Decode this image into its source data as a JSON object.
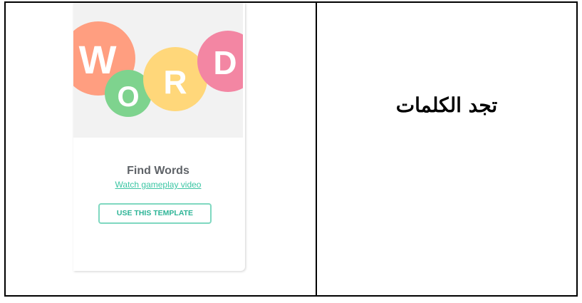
{
  "card": {
    "image_letters": [
      "W",
      "O",
      "R",
      "D"
    ],
    "colors": {
      "w_circle": "#ff9e80",
      "o_circle": "#7ed38e",
      "r_circle": "#ffd77a",
      "d_circle": "#f386a3",
      "image_bg": "#f2f2f2",
      "accent": "#3cc6a4"
    },
    "title": "Find Words",
    "link_text": "Watch gameplay video",
    "button_label": "USE THIS TEMPLATE"
  },
  "right_cell": {
    "text": "تجد الكلمات"
  }
}
